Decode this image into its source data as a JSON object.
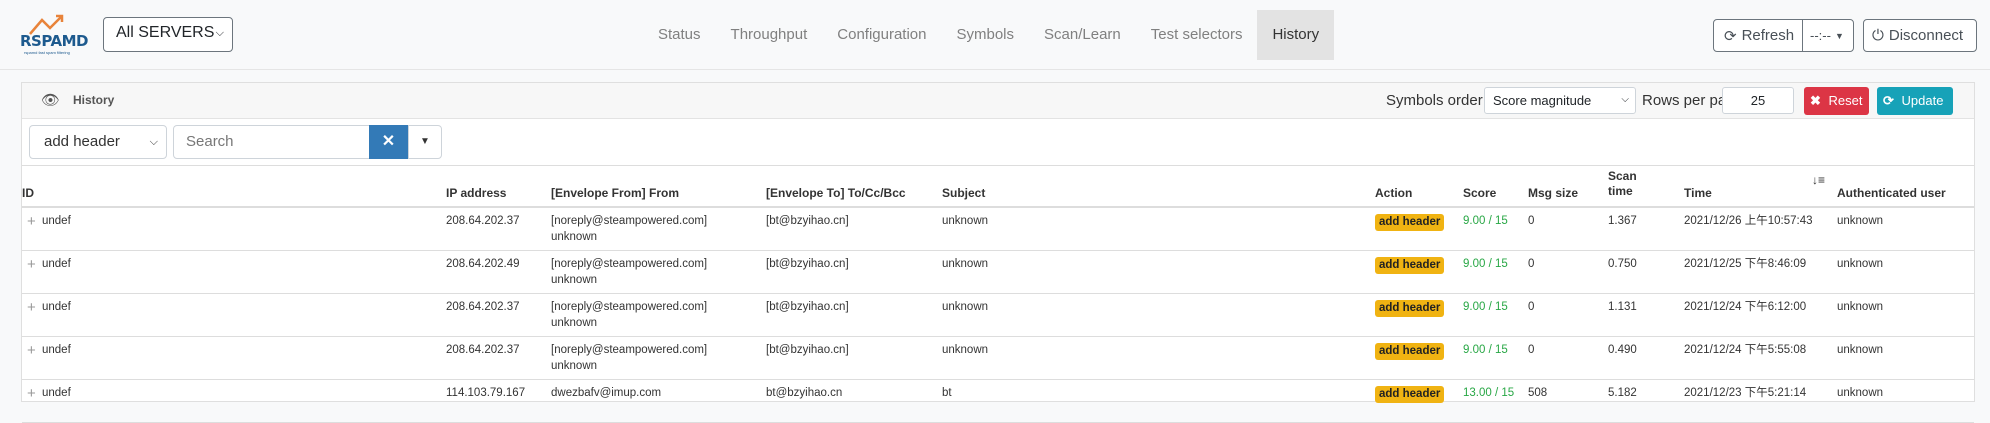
{
  "app": {
    "brand": "RSPAMD",
    "brand_sub": "rspamd fast spam filtering"
  },
  "server_select": {
    "value": "All SERVERS"
  },
  "nav": {
    "tabs": [
      "Status",
      "Throughput",
      "Configuration",
      "Symbols",
      "Scan/Learn",
      "Test selectors",
      "History"
    ],
    "active": "History"
  },
  "toolbar": {
    "refresh_label": "Refresh",
    "time_label": "--:--",
    "disconnect_label": "Disconnect"
  },
  "history": {
    "title": "History",
    "symbols_order_label": "Symbols order:",
    "symbols_order_value": "Score magnitude",
    "rows_per_page_label": "Rows per page:",
    "rows_per_page_value": "25",
    "reset_label": "Reset",
    "update_label": "Update",
    "filter_value": "add header",
    "search_placeholder": "Search",
    "columns": [
      "ID",
      "IP address",
      "[Envelope From] From",
      "[Envelope To] To/Cc/Bcc",
      "Subject",
      "Action",
      "Score",
      "Msg size",
      "Scan time",
      "Time",
      "Authenticated user"
    ],
    "rows": [
      {
        "id": "undef",
        "ip": "208.64.202.37",
        "from": "[noreply@steampowered.com]",
        "from2": "unknown",
        "to": "[bt@bzyihao.cn]",
        "subject": "unknown",
        "action": "add header",
        "score": "9.00 / 15",
        "size": "0",
        "scan_time": "1.367",
        "time": "2021/12/26 上午10:57:43",
        "user": "unknown"
      },
      {
        "id": "undef",
        "ip": "208.64.202.49",
        "from": "[noreply@steampowered.com]",
        "from2": "unknown",
        "to": "[bt@bzyihao.cn]",
        "subject": "unknown",
        "action": "add header",
        "score": "9.00 / 15",
        "size": "0",
        "scan_time": "0.750",
        "time": "2021/12/25 下午8:46:09",
        "user": "unknown"
      },
      {
        "id": "undef",
        "ip": "208.64.202.37",
        "from": "[noreply@steampowered.com]",
        "from2": "unknown",
        "to": "[bt@bzyihao.cn]",
        "subject": "unknown",
        "action": "add header",
        "score": "9.00 / 15",
        "size": "0",
        "scan_time": "1.131",
        "time": "2021/12/24 下午6:12:00",
        "user": "unknown"
      },
      {
        "id": "undef",
        "ip": "208.64.202.37",
        "from": "[noreply@steampowered.com]",
        "from2": "unknown",
        "to": "[bt@bzyihao.cn]",
        "subject": "unknown",
        "action": "add header",
        "score": "9.00 / 15",
        "size": "0",
        "scan_time": "0.490",
        "time": "2021/12/24 下午5:55:08",
        "user": "unknown"
      },
      {
        "id": "undef",
        "ip": "114.103.79.167",
        "from": "dwezbafv@imup.com",
        "from2": "",
        "to": "bt@bzyihao.cn",
        "subject": "bt",
        "action": "add header",
        "score": "13.00 / 15",
        "size": "508",
        "scan_time": "5.182",
        "time": "2021/12/23 下午5:21:14",
        "user": "unknown"
      }
    ]
  },
  "colors": {
    "accent": "#337ab7",
    "reset": "#dc3545",
    "update": "#17a2b8",
    "action_badge": "#f0b312",
    "score": "#28a745"
  }
}
